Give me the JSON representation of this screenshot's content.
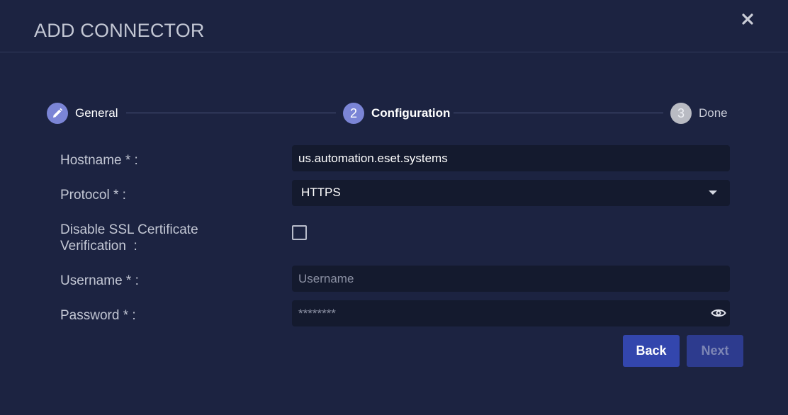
{
  "dialog": {
    "title": "ADD CONNECTOR",
    "close_icon": "close-icon"
  },
  "stepper": {
    "steps": [
      {
        "label": "General",
        "icon": "pencil-icon",
        "state": "completed"
      },
      {
        "label": "Configuration",
        "number": "2",
        "state": "active"
      },
      {
        "label": "Done",
        "number": "3",
        "state": "pending"
      }
    ]
  },
  "form": {
    "hostname": {
      "label": "Hostname * :",
      "value": "us.automation.eset.systems"
    },
    "protocol": {
      "label": "Protocol * :",
      "value": "HTTPS"
    },
    "disable_ssl": {
      "label_line1": "Disable SSL Certificate",
      "label_line2": "Verification  :",
      "checked": false
    },
    "username": {
      "label": "Username * :",
      "value": "",
      "placeholder": "Username"
    },
    "password": {
      "label": "Password * :",
      "value": "********",
      "toggle_icon": "eye-icon"
    }
  },
  "buttons": {
    "back": "Back",
    "next": "Next"
  },
  "colors": {
    "background": "#1c2341",
    "field": "#141a2e",
    "primary": "#3346ad",
    "step_active": "#7b85d6"
  }
}
